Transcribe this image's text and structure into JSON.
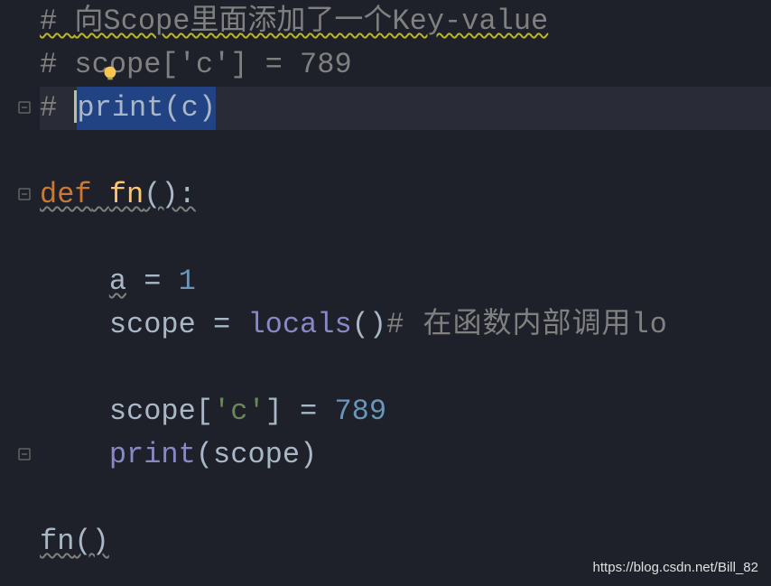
{
  "code": {
    "line1_comment_prefix": "# ",
    "line1_text": "向Scope里面添加了一个Key-value",
    "line2_comment_prefix": "# ",
    "line2_text": "scope['c'] = 789",
    "line3_comment_prefix": "# ",
    "line3_selected": "print(c)",
    "line5_def": "def",
    "line5_space": " ",
    "line5_fn": "fn",
    "line5_paren": "():",
    "line7_a": "a",
    "line7_eq": " = ",
    "line7_num": "1",
    "line8_scope": "scope = ",
    "line8_locals": "locals",
    "line8_paren": "()",
    "line8_comment": "# 在函数内部调用lo",
    "line10_scope": "scope[",
    "line10_str": "'c'",
    "line10_bracket": "] = ",
    "line10_num": "789",
    "line11_print": "print",
    "line11_paren": "(scope)",
    "line13_fn": "fn",
    "line13_paren": "()"
  },
  "watermark": "https://blog.csdn.net/Bill_82",
  "indent1": "    ",
  "indent2": "        ",
  "space_before_comment": " "
}
